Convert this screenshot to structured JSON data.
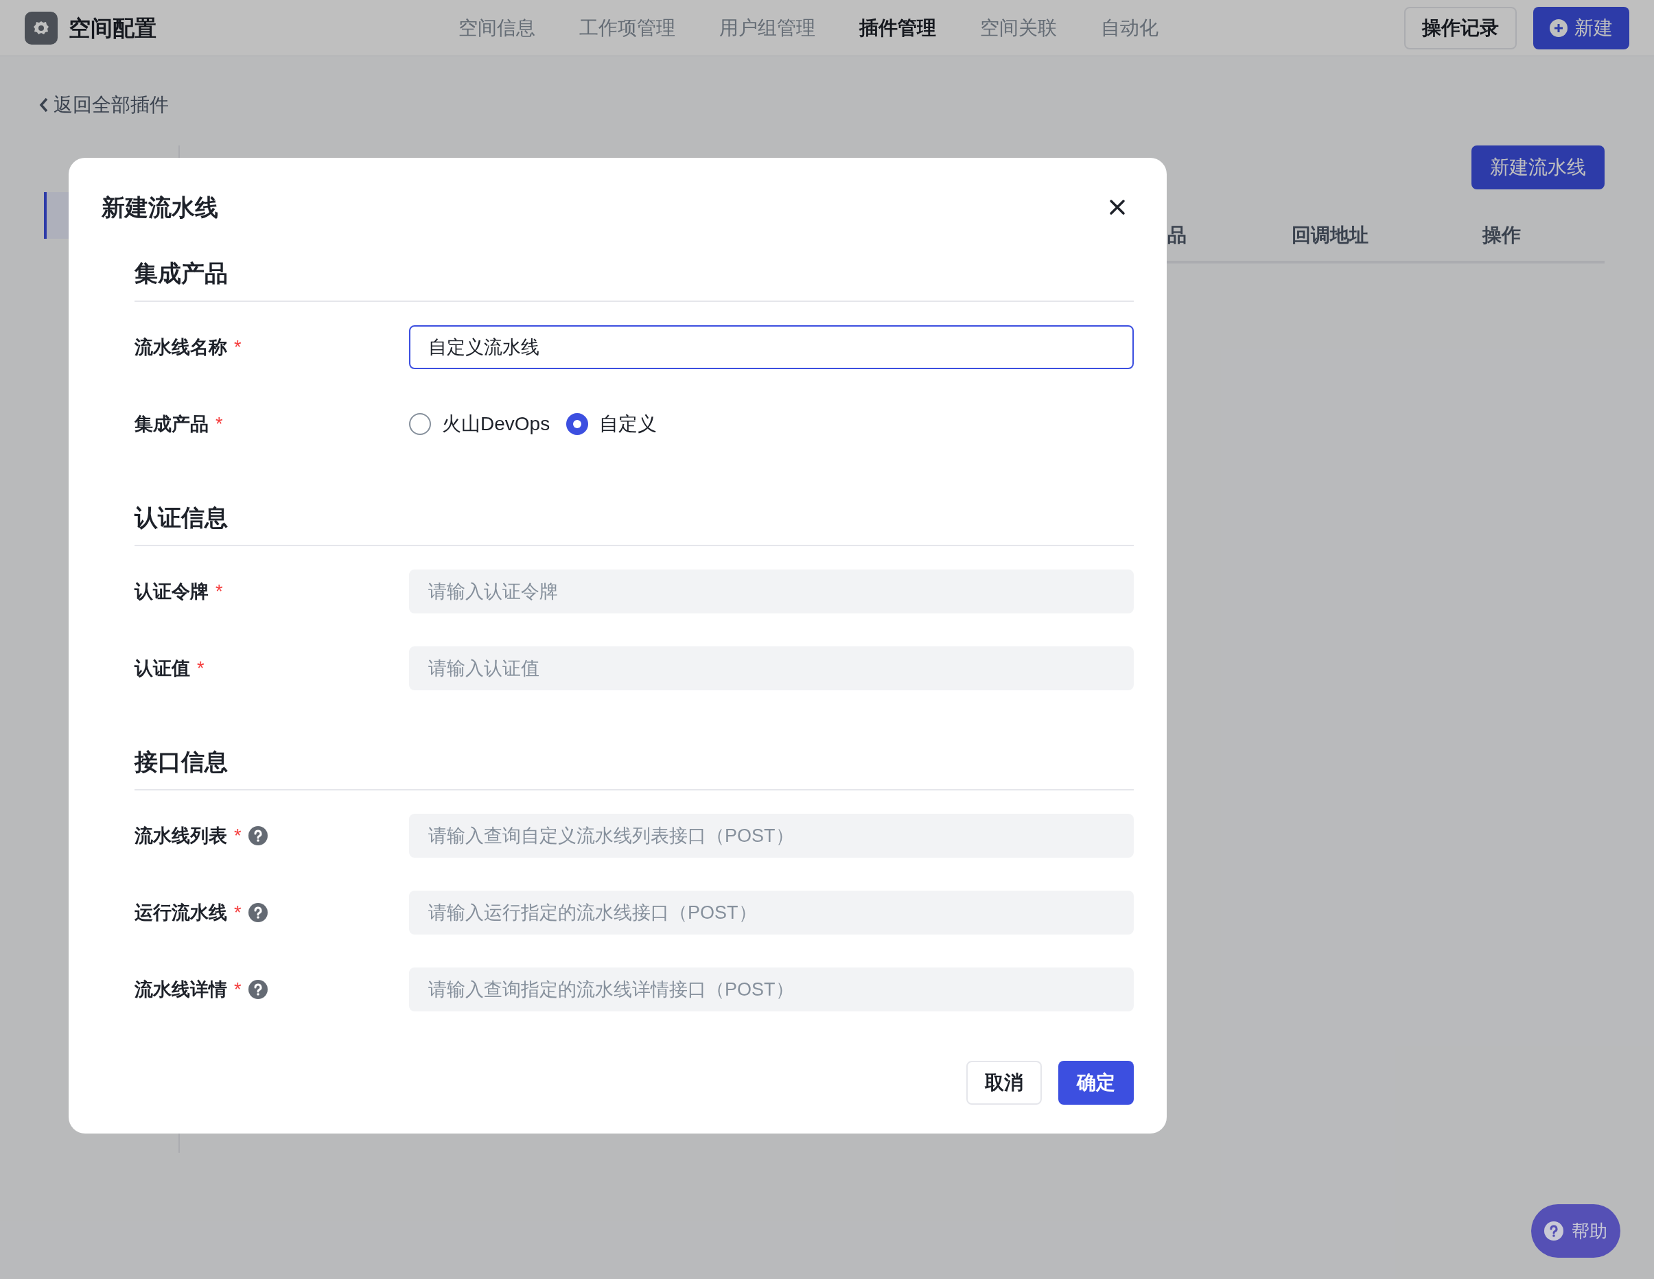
{
  "header": {
    "title": "空间配置",
    "nav": [
      {
        "label": "空间信息",
        "selected": false
      },
      {
        "label": "工作项管理",
        "selected": false
      },
      {
        "label": "用户组管理",
        "selected": false
      },
      {
        "label": "插件管理",
        "selected": true
      },
      {
        "label": "空间关联",
        "selected": false
      },
      {
        "label": "自动化",
        "selected": false
      }
    ],
    "buttons": [
      {
        "label": "操作记录",
        "kind": "secondary"
      },
      {
        "label": "新建",
        "kind": "primary"
      }
    ]
  },
  "back_link": "返回全部插件",
  "new_pipeline_button": "新建流水线",
  "table": {
    "columns": [
      "品",
      "回调地址",
      "操作"
    ]
  },
  "dialog": {
    "title": "新建流水线",
    "sections": [
      {
        "title": "集成产品",
        "fields": [
          {
            "kind": "text",
            "label": "流水线名称",
            "required_mark": "*",
            "help": false,
            "value": "自定义流水线",
            "focused": true
          },
          {
            "kind": "radio",
            "label": "集成产品",
            "required_mark": "*",
            "help": false,
            "options": [
              {
                "label": "火山DevOps",
                "selected": false
              },
              {
                "label": "自定义",
                "selected": true
              }
            ]
          }
        ]
      },
      {
        "title": "认证信息",
        "fields": [
          {
            "kind": "text",
            "label": "认证令牌",
            "required_mark": "*",
            "help": false,
            "placeholder": "请输入认证令牌",
            "focused": false
          },
          {
            "kind": "text",
            "label": "认证值",
            "required_mark": "*",
            "help": false,
            "placeholder": "请输入认证值",
            "focused": false
          }
        ]
      },
      {
        "title": "接口信息",
        "fields": [
          {
            "kind": "text",
            "label": "流水线列表",
            "required_mark": "*",
            "help": true,
            "placeholder": "请输入查询自定义流水线列表接口（POST）",
            "focused": false
          },
          {
            "kind": "text",
            "label": "运行流水线",
            "required_mark": "*",
            "help": true,
            "placeholder": "请输入运行指定的流水线接口（POST）",
            "focused": false
          },
          {
            "kind": "text",
            "label": "流水线详情",
            "required_mark": "*",
            "help": true,
            "placeholder": "请输入查询指定的流水线详情接口（POST）",
            "focused": false
          }
        ]
      }
    ],
    "buttons": [
      {
        "label": "取消",
        "kind": "secondary"
      },
      {
        "label": "确定",
        "kind": "primary"
      }
    ]
  },
  "help_button": "帮助"
}
